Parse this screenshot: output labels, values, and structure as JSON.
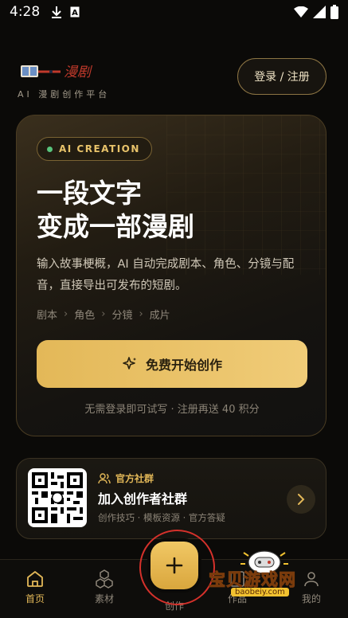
{
  "status": {
    "time": "4:28"
  },
  "header": {
    "logo_text": "漫剧",
    "subtitle": "AI 漫剧创作平台",
    "login_label": "登录 / 注册"
  },
  "hero": {
    "badge": "AI CREATION",
    "title_line1": "一段文字",
    "title_line2": "变成一部漫剧",
    "description": "输入故事梗概，AI 自动完成剧本、角色、分镜与配音，直接导出可发布的短剧。",
    "steps": [
      "剧本",
      "角色",
      "分镜",
      "成片"
    ],
    "cta_label": "免费开始创作",
    "note": "无需登录即可试写 · 注册再送 40 积分"
  },
  "community": {
    "tag": "官方社群",
    "title": "加入创作者社群",
    "subtitle": "创作技巧 · 模板资源 · 官方答疑"
  },
  "nav": {
    "home": "首页",
    "assets": "素材",
    "create": "创作",
    "works": "作品",
    "mine": "我的"
  },
  "watermark": {
    "text": "宝贝游戏网",
    "url": "baobeiy.com"
  },
  "colors": {
    "accent": "#e3b858",
    "background": "#0b0a08"
  }
}
